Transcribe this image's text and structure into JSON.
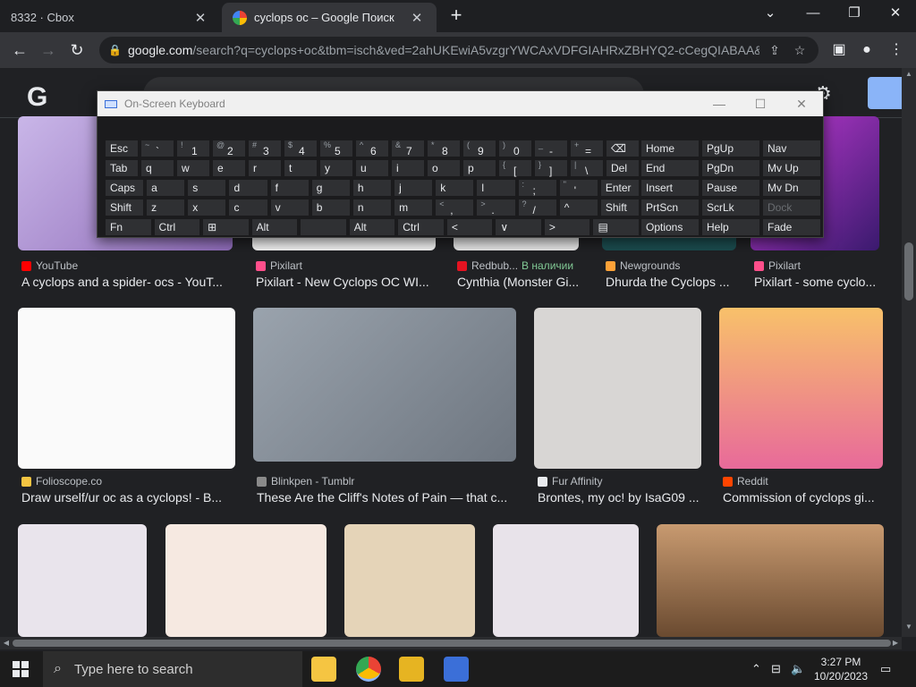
{
  "browser": {
    "tabs": [
      {
        "title": "8332 · Cbox",
        "active": false
      },
      {
        "title": "cyclops oc – Google Поиск",
        "active": true
      }
    ],
    "address": {
      "host": "google.com",
      "path": "/search?q=cyclops+oc&tbm=isch&ved=2ahUKEwiA5vzgrYWCAxVDFGIAHRxZBHYQ2-cCegQIABAA&..."
    }
  },
  "osk": {
    "title": "On-Screen Keyboard",
    "rows": [
      [
        {
          "k": "Esc"
        },
        {
          "s": "~",
          "m": "`"
        },
        {
          "s": "!",
          "m": "1"
        },
        {
          "s": "@",
          "m": "2"
        },
        {
          "s": "#",
          "m": "3"
        },
        {
          "s": "$",
          "m": "4"
        },
        {
          "s": "%",
          "m": "5"
        },
        {
          "s": "^",
          "m": "6"
        },
        {
          "s": "&",
          "m": "7"
        },
        {
          "s": "*",
          "m": "8"
        },
        {
          "s": "(",
          "m": "9"
        },
        {
          "s": ")",
          "m": "0"
        },
        {
          "s": "_",
          "m": "-"
        },
        {
          "s": "+",
          "m": "="
        },
        {
          "k": "⌫"
        }
      ],
      [
        {
          "k": "Tab"
        },
        {
          "k": "q"
        },
        {
          "k": "w"
        },
        {
          "k": "e"
        },
        {
          "k": "r"
        },
        {
          "k": "t"
        },
        {
          "k": "y"
        },
        {
          "k": "u"
        },
        {
          "k": "i"
        },
        {
          "k": "o"
        },
        {
          "k": "p"
        },
        {
          "s": "{",
          "m": "["
        },
        {
          "s": "}",
          "m": "]"
        },
        {
          "s": "|",
          "m": "\\"
        },
        {
          "k": "Del"
        }
      ],
      [
        {
          "k": "Caps"
        },
        {
          "k": "a"
        },
        {
          "k": "s"
        },
        {
          "k": "d"
        },
        {
          "k": "f"
        },
        {
          "k": "g"
        },
        {
          "k": "h"
        },
        {
          "k": "j"
        },
        {
          "k": "k"
        },
        {
          "k": "l"
        },
        {
          "s": ":",
          "m": ";"
        },
        {
          "s": "\"",
          "m": "'"
        },
        {
          "k": "Enter"
        }
      ],
      [
        {
          "k": "Shift"
        },
        {
          "k": "z"
        },
        {
          "k": "x"
        },
        {
          "k": "c"
        },
        {
          "k": "v"
        },
        {
          "k": "b"
        },
        {
          "k": "n"
        },
        {
          "k": "m"
        },
        {
          "s": "<",
          "m": ","
        },
        {
          "s": ">",
          "m": "."
        },
        {
          "s": "?",
          "m": "/"
        },
        {
          "k": "^"
        },
        {
          "k": "Shift"
        }
      ],
      [
        {
          "k": "Fn"
        },
        {
          "k": "Ctrl"
        },
        {
          "k": "⊞"
        },
        {
          "k": "Alt"
        },
        {
          "k": ""
        },
        {
          "k": "Alt"
        },
        {
          "k": "Ctrl"
        },
        {
          "k": "<"
        },
        {
          "k": "∨"
        },
        {
          "k": ">"
        },
        {
          "k": "▤"
        }
      ]
    ],
    "nav_cols": [
      [
        "Home",
        "End",
        "Insert",
        "PrtScn",
        "Options"
      ],
      [
        "PgUp",
        "PgDn",
        "Pause",
        "ScrLk",
        "Help"
      ],
      [
        "Nav",
        "Mv Up",
        "Mv Dn",
        "Dock",
        "Fade"
      ]
    ]
  },
  "results": {
    "row1": [
      {
        "source": "YouTube",
        "title": "A cyclops and a spider- ocs - YouT...",
        "icon_color": "#ff0000"
      },
      {
        "source": "Pixilart",
        "title": "Pixilart - New Cyclops OC WI...",
        "icon_color": "#ff4f8b"
      },
      {
        "source": "Redbub...",
        "stock": "В наличии",
        "title": "Cynthia (Monster Gi...",
        "icon_color": "#e41321"
      },
      {
        "source": "Newgrounds",
        "title": "Dhurda the Cyclops ...",
        "icon_color": "#fda238"
      },
      {
        "source": "Pixilart",
        "title": "Pixilart - some cyclo...",
        "icon_color": "#ff4f8b"
      }
    ],
    "row2": [
      {
        "source": "Folioscope.co",
        "title": "Draw urself/ur oc as a cyclops! - B...",
        "icon_color": "#f5c542"
      },
      {
        "source": "Blinkpen - Tumblr",
        "title": "These Are the Cliff's Notes of Pain — that c...",
        "icon_color": "#8a8a8a"
      },
      {
        "source": "Fur Affinity",
        "title": "Brontes, my oc! by IsaG09 ...",
        "icon_color": "#e8eaed"
      },
      {
        "source": "Reddit",
        "title": "Commission of cyclops gi...",
        "icon_color": "#ff4500"
      }
    ]
  },
  "taskbar": {
    "search_placeholder": "Type here to search",
    "time": "3:27 PM",
    "date": "10/20/2023"
  }
}
